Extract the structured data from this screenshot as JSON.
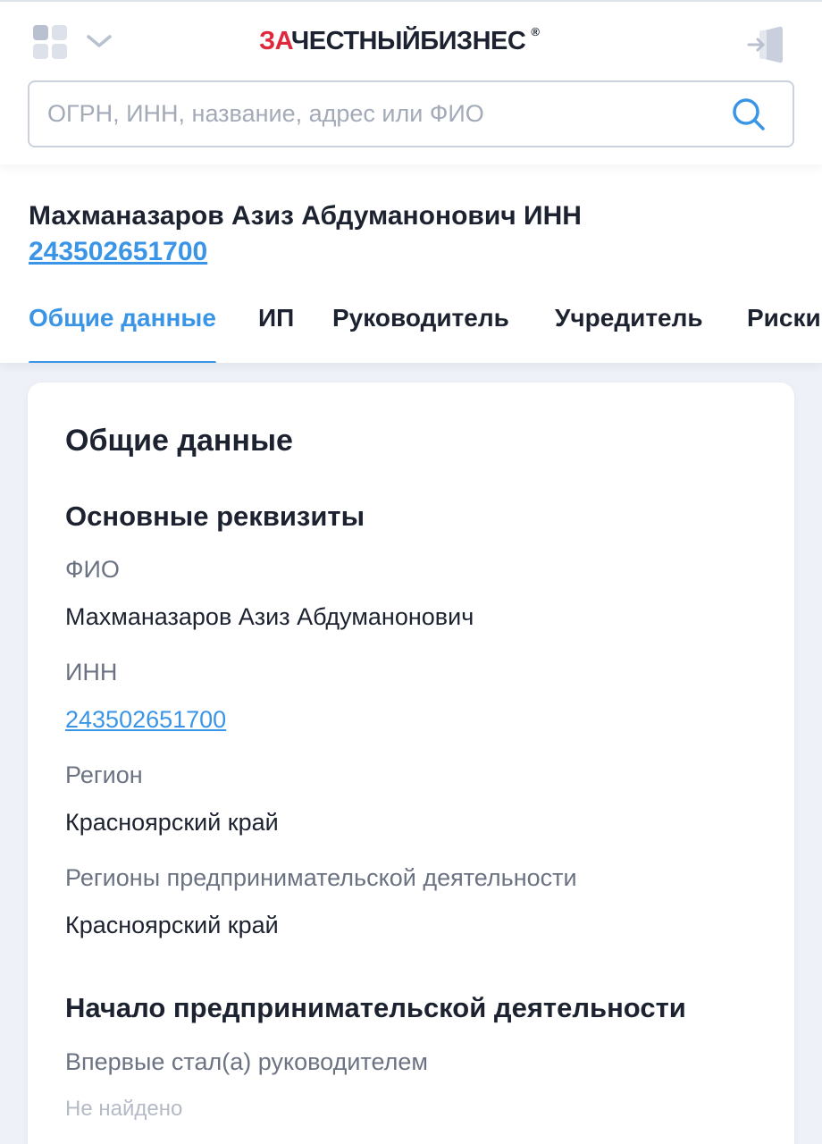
{
  "header": {
    "logo_accent": "ЗА",
    "logo_main": "ЧЕСТНЫЙБИЗНЕС",
    "logo_reg": "®",
    "search_placeholder": "ОГРН, ИНН, название, адрес или ФИО",
    "icons": [
      "apps-icon",
      "chevron-down-icon",
      "login-icon",
      "search-icon"
    ]
  },
  "subject": {
    "name": "Махманазаров Азиз Абдуманонович ИНН",
    "inn": "243502651700"
  },
  "tabs": [
    {
      "label": "Общие данные",
      "active": true
    },
    {
      "label": "ИП",
      "active": false
    },
    {
      "label": "Руководитель",
      "active": false
    },
    {
      "label": "Учредитель",
      "active": false
    },
    {
      "label": "Риски",
      "active": false
    }
  ],
  "card": {
    "title": "Общие данные",
    "section_main": "Основные реквизиты",
    "fields": [
      {
        "label": "ФИО",
        "value": "Махманазаров Азиз Абдуманонович"
      },
      {
        "label": "ИНН",
        "value": "243502651700"
      },
      {
        "label": "Регион",
        "value": "Красноярский край"
      },
      {
        "label": "Регионы предпринимательской деятельности",
        "value": "Красноярский край"
      }
    ],
    "section_start": "Начало предпринимательской деятельности",
    "start_fields": [
      {
        "label": "Впервые стал(а) руководителем",
        "value": "Не найдено"
      }
    ]
  },
  "colors": {
    "accent": "#3b95e6",
    "logo_red": "#e0283c",
    "text": "#1c2230",
    "muted": "#6b7383",
    "background": "#eef1f7"
  }
}
